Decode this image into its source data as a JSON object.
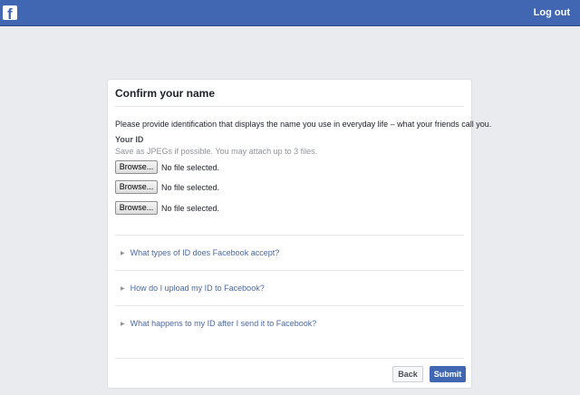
{
  "topbar": {
    "logo_letter": "f",
    "logout_label": "Log out"
  },
  "form": {
    "title": "Confirm your name",
    "intro": "Please provide identification that displays the name you use in everyday life – what your friends call you.",
    "id_label": "Your ID",
    "id_hint": "Save as JPEGs if possible. You may attach up to 3 files.",
    "files": [
      {
        "button": "Browse...",
        "status": "No file selected."
      },
      {
        "button": "Browse...",
        "status": "No file selected."
      },
      {
        "button": "Browse...",
        "status": "No file selected."
      }
    ],
    "faqs": [
      {
        "label": "What types of ID does Facebook accept?"
      },
      {
        "label": "How do I upload my ID to Facebook?"
      },
      {
        "label": "What happens to my ID after I send it to Facebook?"
      }
    ],
    "back_label": "Back",
    "submit_label": "Submit"
  },
  "colors": {
    "brand": "#4267b2",
    "background": "#e9ebee",
    "link": "#4b67a1"
  },
  "icons": {
    "logo": "facebook-logo",
    "faq_arrow": "triangle-right-icon"
  }
}
